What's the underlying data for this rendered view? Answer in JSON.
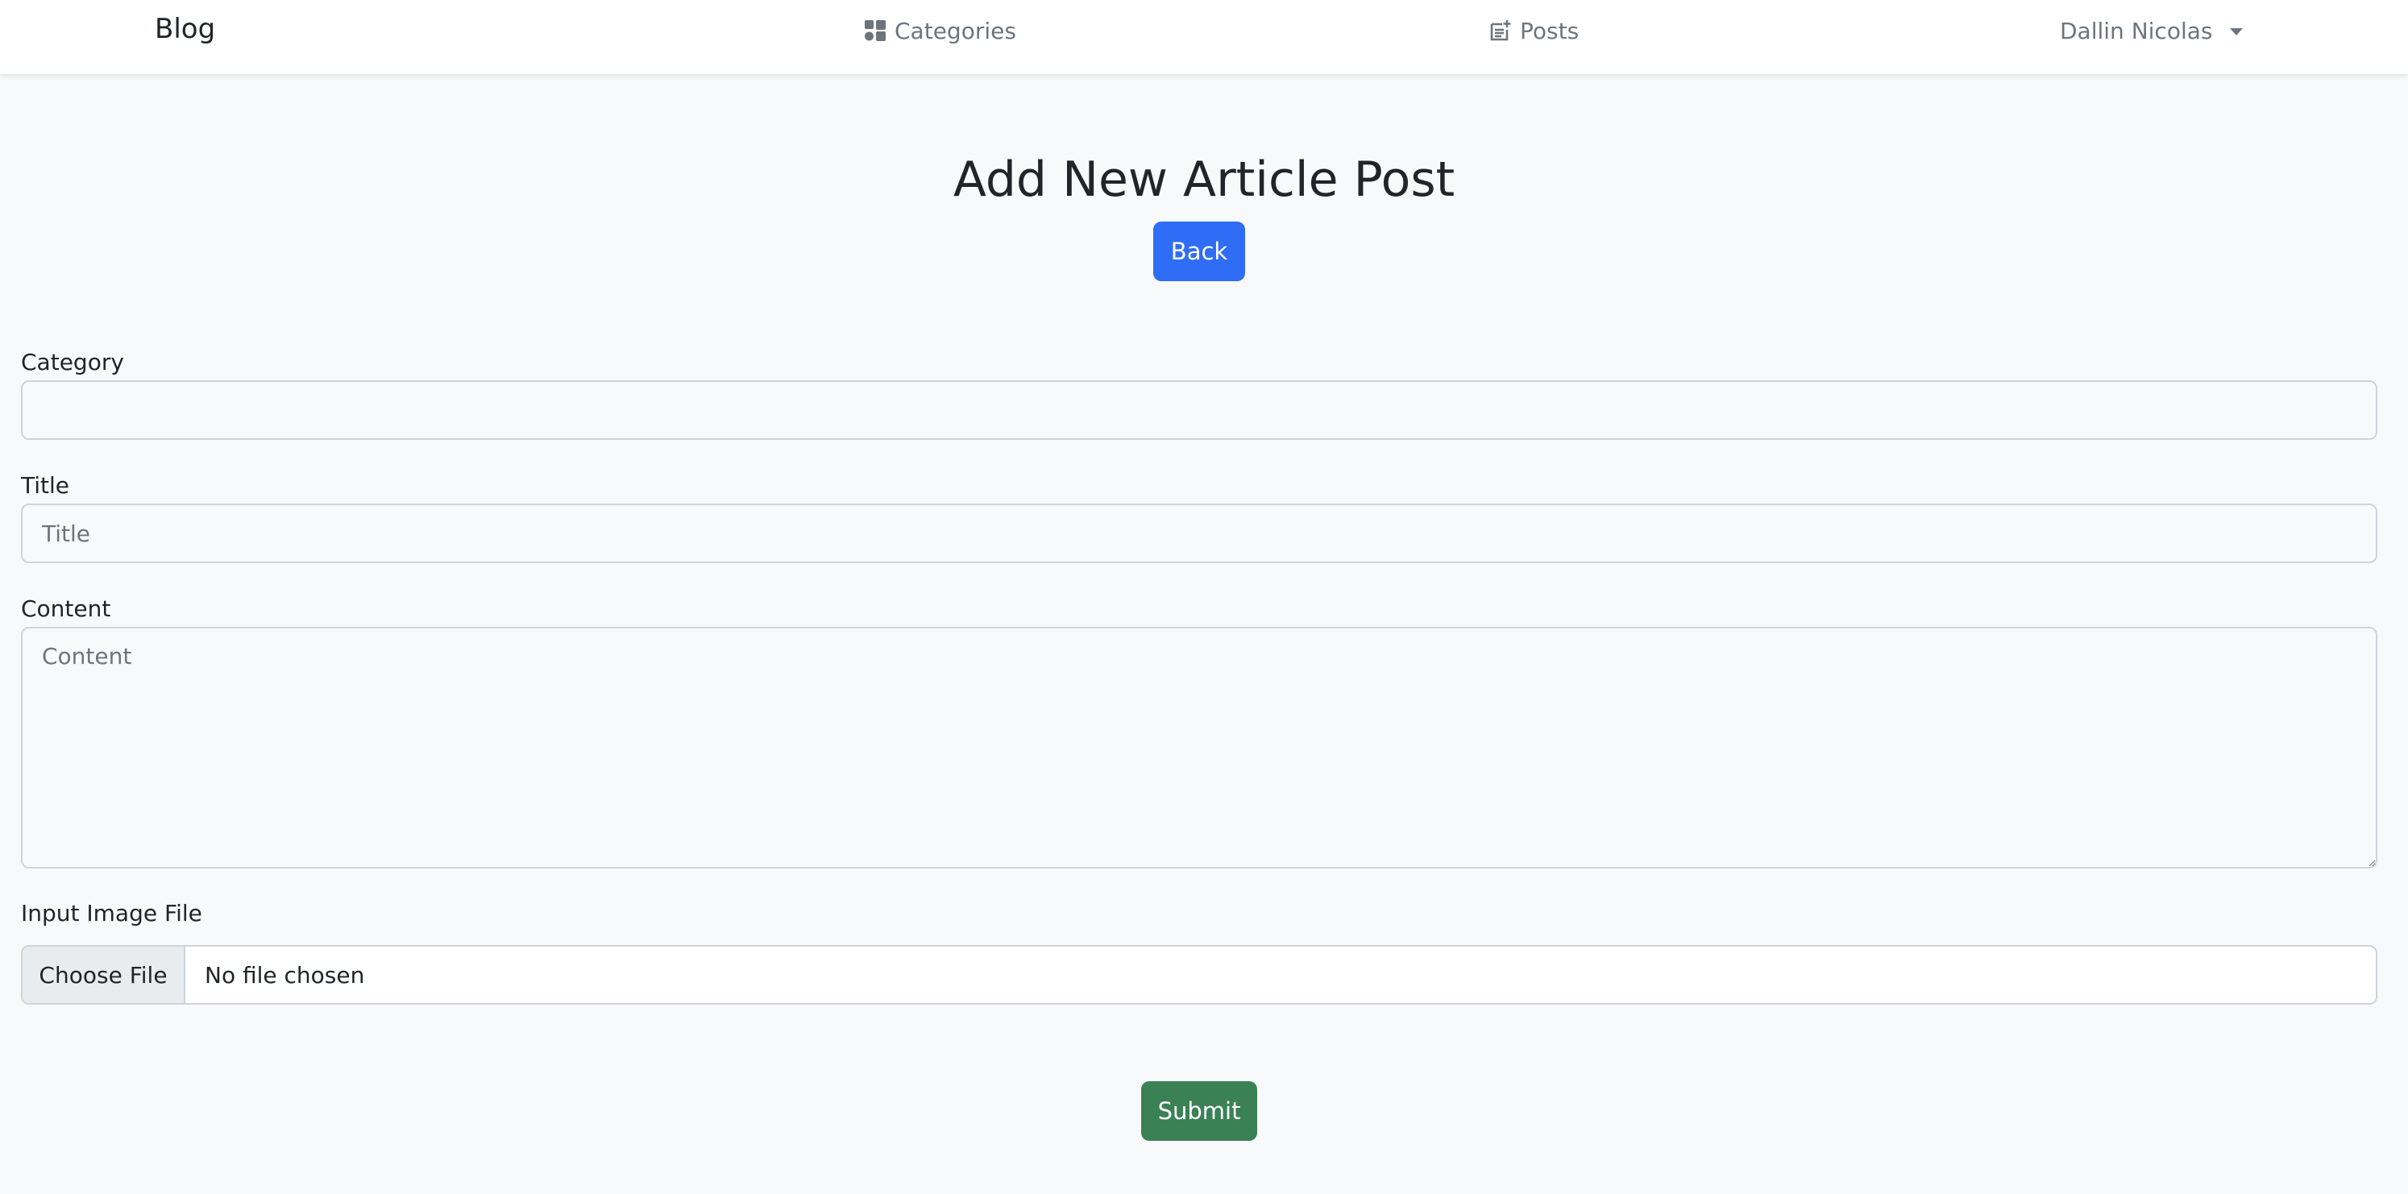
{
  "navbar": {
    "brand": "Blog",
    "links": [
      {
        "label": "Categories",
        "icon": "categories-grid-icon"
      },
      {
        "label": "Posts",
        "icon": "post-add-icon"
      }
    ],
    "user": {
      "name": "Dallin Nicolas",
      "icon": "chevron-down-icon"
    }
  },
  "page": {
    "title": "Add New Article Post",
    "back_label": "Back",
    "submit_label": "Submit"
  },
  "form": {
    "category": {
      "label": "Category",
      "value": ""
    },
    "title": {
      "label": "Title",
      "placeholder": "Title",
      "value": ""
    },
    "content": {
      "label": "Content",
      "placeholder": "Content",
      "value": ""
    },
    "image": {
      "label": "Input Image File",
      "button_label": "Choose File",
      "status": "No file chosen"
    }
  },
  "colors": {
    "primary": "#2f6df6",
    "success": "#3a8156",
    "background": "#f8f9fa",
    "border": "#ced4da",
    "muted": "#6c757d"
  }
}
